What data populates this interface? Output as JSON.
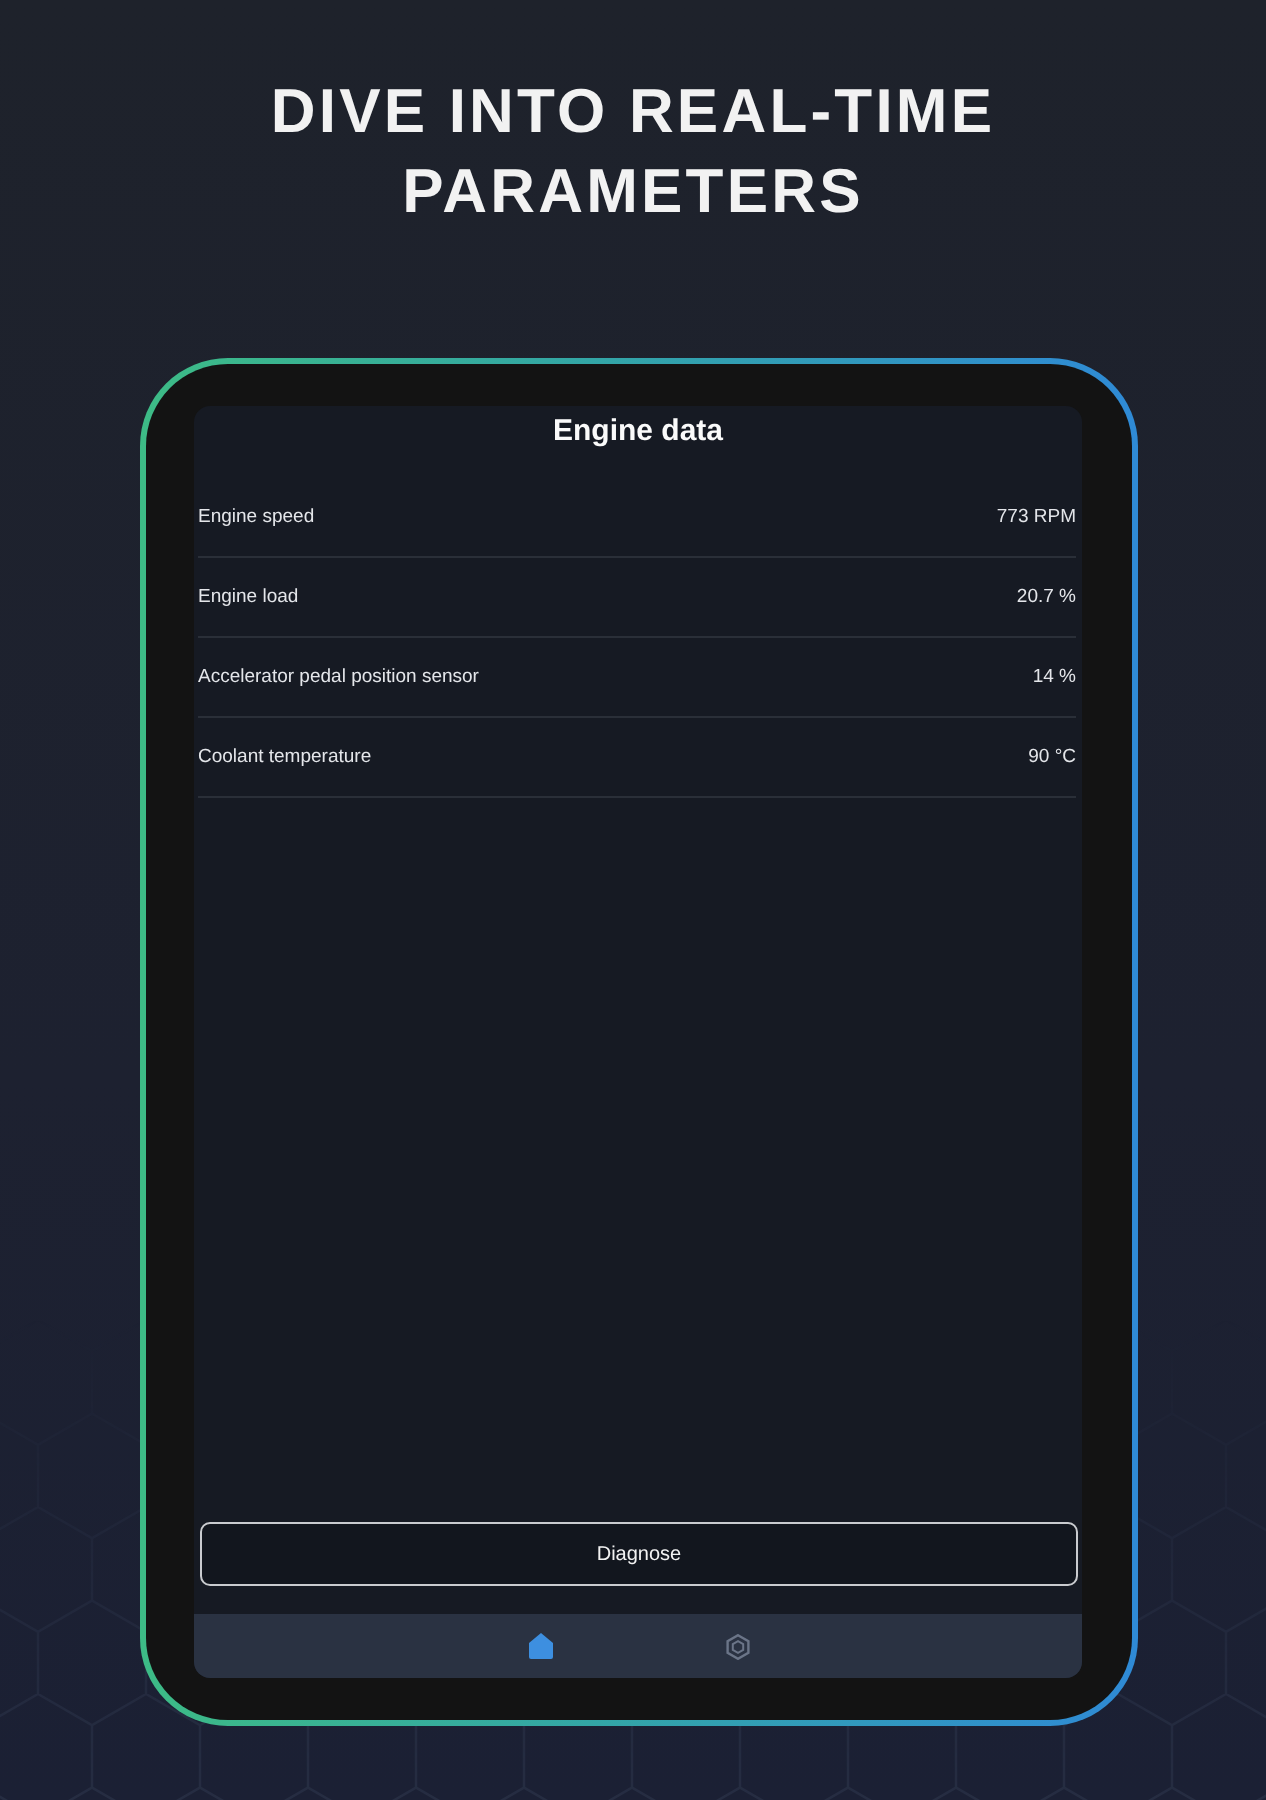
{
  "headline": "DIVE INTO REAL-TIME PARAMETERS",
  "device": {
    "screen": {
      "title": "Engine data",
      "parameters": [
        {
          "name": "Engine speed",
          "value": "773 RPM"
        },
        {
          "name": "Engine load",
          "value": "20.7 %"
        },
        {
          "name": "Accelerator pedal position sensor",
          "value": "14 %"
        },
        {
          "name": "Coolant temperature",
          "value": "90 °C"
        }
      ],
      "action_button": "Diagnose",
      "nav": [
        {
          "kind": "home",
          "selected": true
        },
        {
          "kind": "hexagon",
          "selected": false
        }
      ]
    }
  }
}
